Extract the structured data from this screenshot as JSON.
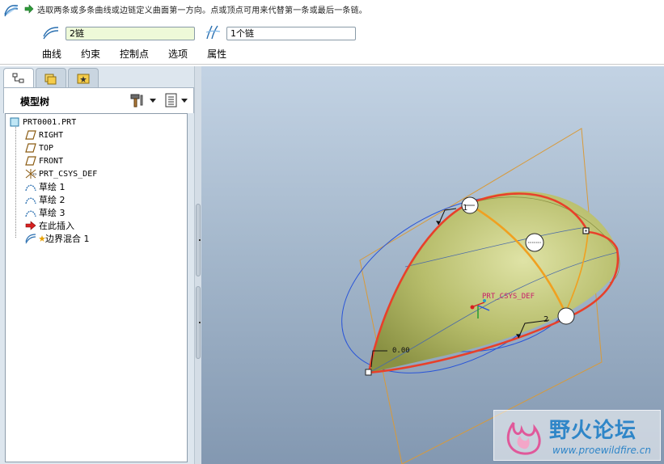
{
  "dashboard": {
    "prompt": "选取两条或多条曲线或边链定义曲面第一方向。点或顶点可用来代替第一条或最后一条链。",
    "field1_value": "2链",
    "field2_value": "1个链",
    "tabs": [
      "曲线",
      "约束",
      "控制点",
      "选项",
      "属性"
    ]
  },
  "navigator": {
    "title": "模型树",
    "tree": [
      {
        "label": "PRT0001.PRT",
        "icon": "part-icon",
        "indent": 0
      },
      {
        "label": "RIGHT",
        "icon": "datum-plane-icon",
        "indent": 1
      },
      {
        "label": "TOP",
        "icon": "datum-plane-icon",
        "indent": 1
      },
      {
        "label": "FRONT",
        "icon": "datum-plane-icon",
        "indent": 1
      },
      {
        "label": "PRT_CSYS_DEF",
        "icon": "csys-icon",
        "indent": 1
      },
      {
        "label": "草绘 1",
        "icon": "sketch-icon",
        "indent": 1
      },
      {
        "label": "草绘 2",
        "icon": "sketch-icon",
        "indent": 1
      },
      {
        "label": "草绘 3",
        "icon": "sketch-icon",
        "indent": 1
      },
      {
        "label": "在此插入",
        "icon": "insert-arrow-icon",
        "indent": 1
      },
      {
        "label": "边界混合 1",
        "icon": "boundary-blend-icon",
        "indent": 1
      }
    ]
  },
  "viewport": {
    "csys_label": "PRT_CSYS_DEF",
    "marker_1": "1",
    "marker_2": "2",
    "dimension_label": "0.00"
  },
  "watermark": {
    "title": "野火论坛",
    "url": "www.proewildfire.cn"
  },
  "colors": {
    "surface": "#b7bd6b",
    "chain_red": "#e8402a",
    "chain_orange": "#f0a020",
    "sketch_blue": "#2a55d8",
    "datum_orange": "#d89a3a"
  }
}
